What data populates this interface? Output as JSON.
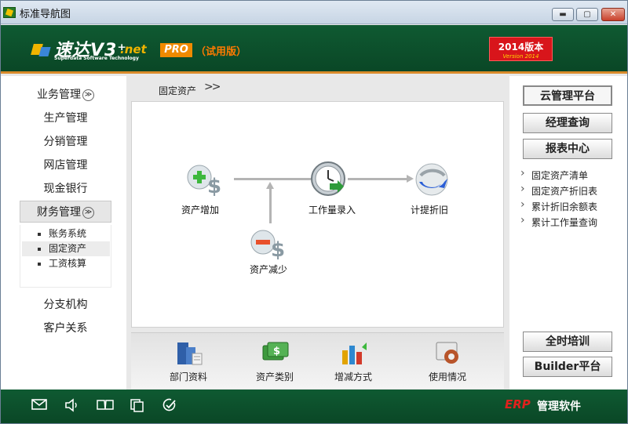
{
  "window": {
    "title": "标准导航图",
    "min_glyph": "▬",
    "max_glyph": "▢",
    "close_glyph": "✕"
  },
  "banner": {
    "logo_name": "速达V3⁺",
    "logo_net": ".net",
    "logo_sub": "Superdata Software Technology",
    "pro": "PRO",
    "trial": "（试用版）",
    "version_main": "2014版本",
    "version_sub": "Version 2014"
  },
  "leftnav": {
    "items": [
      {
        "label": "业务管理",
        "chevron": "≫"
      },
      {
        "label": "生产管理"
      },
      {
        "label": "分销管理"
      },
      {
        "label": "网店管理"
      },
      {
        "label": "现金银行"
      },
      {
        "label": "财务管理",
        "chevron": "≫"
      },
      {
        "label": "分支机构"
      },
      {
        "label": "客户关系"
      }
    ],
    "sub_items": [
      {
        "label": "账务系统"
      },
      {
        "label": "固定资产"
      },
      {
        "label": "工资核算"
      }
    ]
  },
  "main": {
    "breadcrumb": "固定资产",
    "breadcrumb_arrow": ">>",
    "nodes": [
      {
        "label": "资产增加",
        "icon": "asset-add-icon"
      },
      {
        "label": "工作量录入",
        "icon": "clock-icon"
      },
      {
        "label": "计提折旧",
        "icon": "refresh-globe-icon"
      },
      {
        "label": "资产减少",
        "icon": "asset-reduce-icon"
      }
    ],
    "bottom": [
      {
        "label": "部门资料",
        "icon": "building-icon"
      },
      {
        "label": "资产类别",
        "icon": "money-icon"
      },
      {
        "label": "增减方式",
        "icon": "bar-chart-icon"
      },
      {
        "label": "使用情况",
        "icon": "gear-icon"
      }
    ]
  },
  "right": {
    "buttons_top": [
      "云管理平台",
      "经理查询",
      "报表中心"
    ],
    "links": [
      "固定资产清单",
      "固定资产折旧表",
      "累计折旧余额表",
      "累计工作量查询"
    ],
    "buttons_bottom": [
      "全时培训",
      "Builder平台"
    ]
  },
  "footer": {
    "erp": "ERP",
    "brand": "管理软件",
    "icons": [
      "mail-icon",
      "speaker-icon",
      "book-icon",
      "copy-icon",
      "check-icon"
    ]
  },
  "colors": {
    "banner_green": "#0a4726",
    "accent_orange": "#d98b2a",
    "version_red": "#d8151b",
    "erp_red": "#e0211d"
  }
}
